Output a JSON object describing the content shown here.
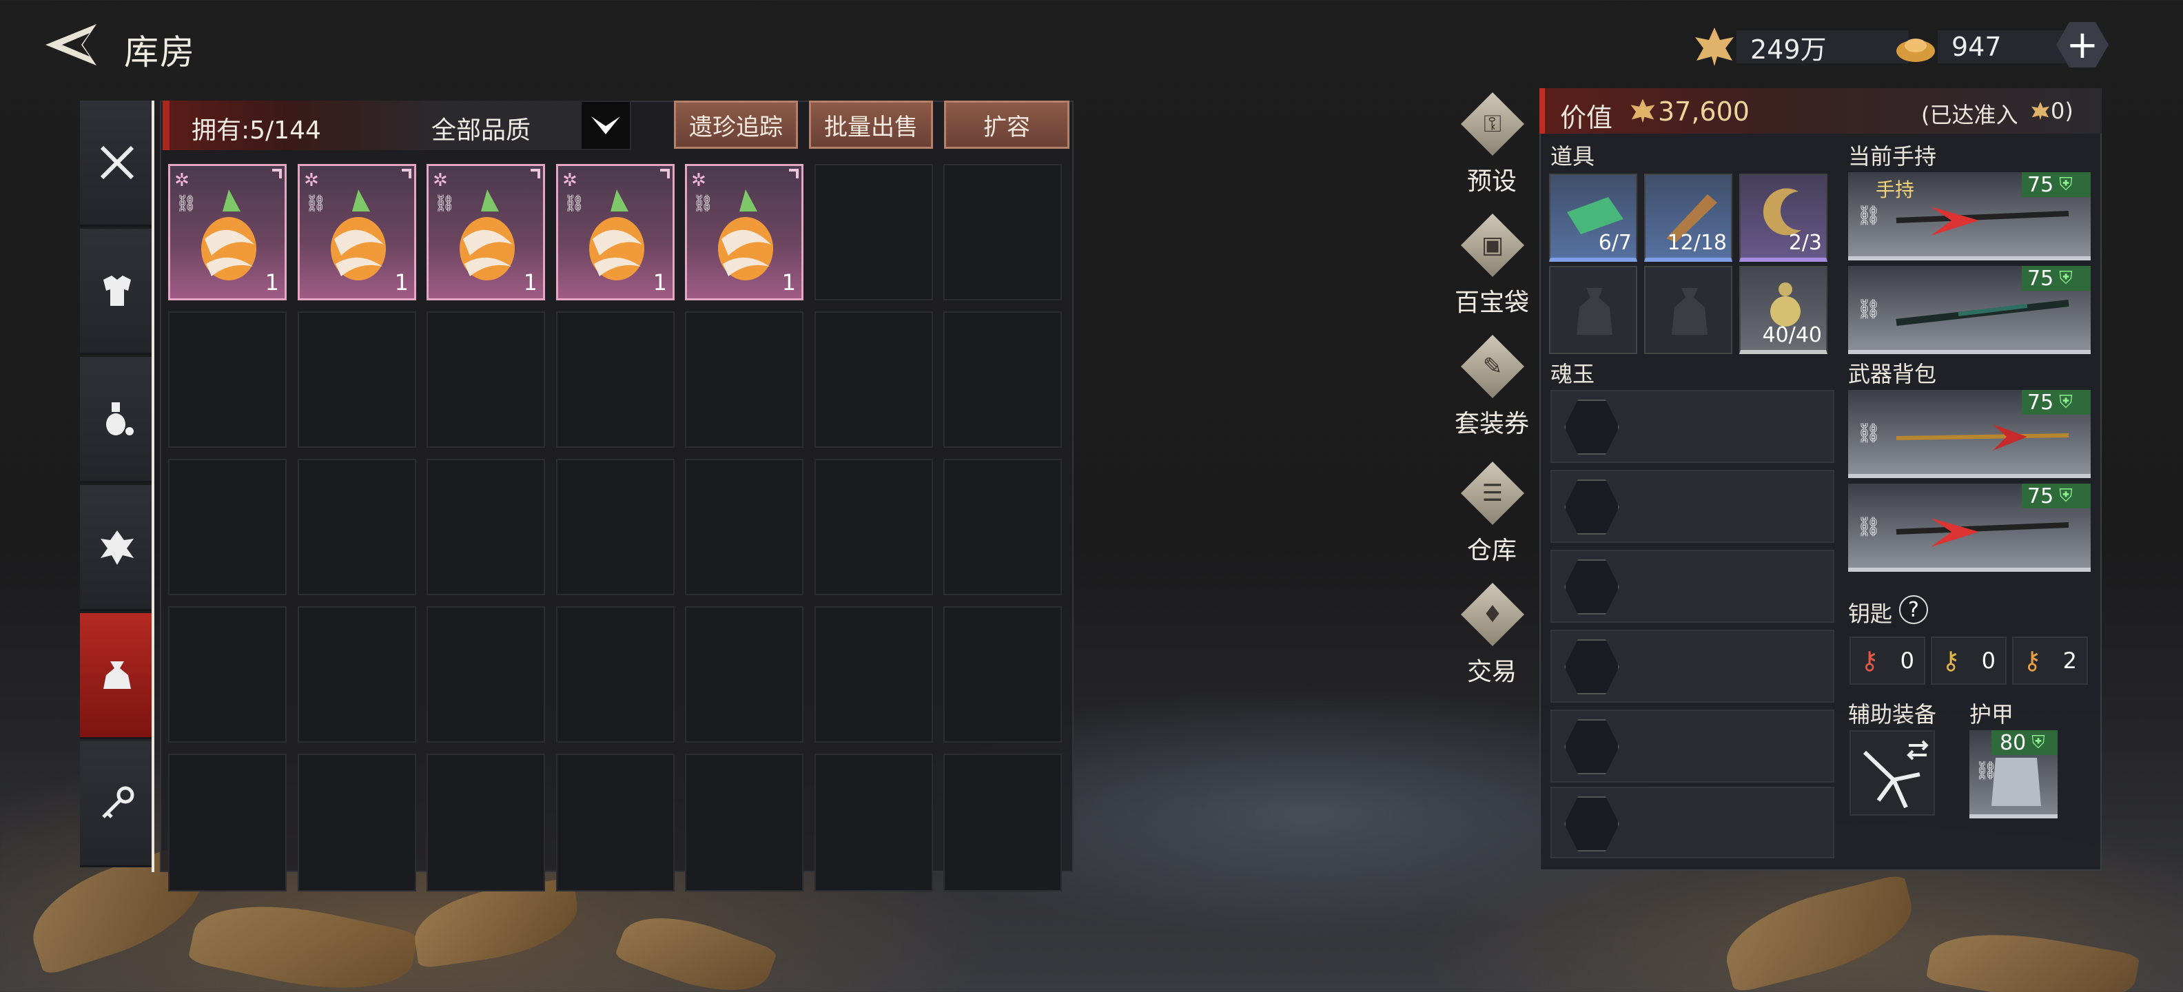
{
  "header": {
    "title": "库房",
    "currency_leaf": "249万",
    "currency_ingot": "947"
  },
  "sidebar": {
    "tabs": [
      {
        "name": "weapons-icon"
      },
      {
        "name": "armor-icon"
      },
      {
        "name": "potion-icon"
      },
      {
        "name": "emblem-icon"
      },
      {
        "name": "bag-icon",
        "active": true
      },
      {
        "name": "key-icon"
      }
    ]
  },
  "storage": {
    "owned": "拥有:5/144",
    "quality_filter": "全部品质",
    "buttons": {
      "track": "遗珍追踪",
      "bulk_sell": "批量出售",
      "expand": "扩容"
    },
    "items": [
      {
        "qty": "1"
      },
      {
        "qty": "1"
      },
      {
        "qty": "1"
      },
      {
        "qty": "1"
      },
      {
        "qty": "1"
      }
    ]
  },
  "menu": [
    {
      "label": "预设",
      "icon": "preset-icon"
    },
    {
      "label": "百宝袋",
      "icon": "chest-icon"
    },
    {
      "label": "套装券",
      "icon": "coupon-icon"
    },
    {
      "label": "仓库",
      "icon": "warehouse-icon"
    },
    {
      "label": "交易",
      "icon": "trade-icon"
    }
  ],
  "loadout": {
    "value_label": "价值",
    "value": "37,600",
    "admission": "(已达准入",
    "admission_value": "0)",
    "props_label": "道具",
    "props": [
      {
        "count": "6/7"
      },
      {
        "count": "12/18"
      },
      {
        "count": "2/3"
      },
      {
        "count": ""
      },
      {
        "count": ""
      },
      {
        "count": "40/40"
      }
    ],
    "soul_label": "魂玉",
    "current_label": "当前手持",
    "hand_tag": "手持",
    "current_weapons": [
      {
        "level": "75"
      },
      {
        "level": "75"
      }
    ],
    "bag_label": "武器背包",
    "bag_weapons": [
      {
        "level": "75"
      },
      {
        "level": "75"
      }
    ],
    "keys_label": "钥匙",
    "help": "?",
    "keys": [
      "0",
      "0",
      "2"
    ],
    "aux_label": "辅助装备",
    "armor_label": "护甲",
    "armor_level": "80"
  },
  "colors": {
    "accent_red": "#b42a22",
    "rare_pink": "#e5a6c3",
    "level_green": "#2f6b3a"
  }
}
